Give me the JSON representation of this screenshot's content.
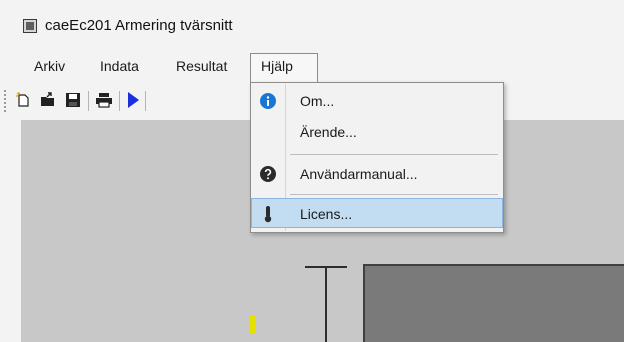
{
  "window": {
    "title": "caeEc201 Armering tvärsnitt",
    "icon": "app-window-icon"
  },
  "menubar": {
    "items": [
      {
        "label": "Arkiv"
      },
      {
        "label": "Indata"
      },
      {
        "label": "Resultat"
      },
      {
        "label": "Hjälp",
        "open": true
      }
    ]
  },
  "toolbar": {
    "buttons": [
      {
        "icon": "new-file-icon"
      },
      {
        "icon": "open-folder-icon"
      },
      {
        "icon": "save-icon"
      },
      {
        "icon": "print-icon"
      },
      {
        "icon": "run-icon",
        "color": "#1a2fe0"
      }
    ]
  },
  "help_menu": {
    "items": [
      {
        "label": "Om...",
        "icon": "info-icon",
        "icon_color": "#1976d2"
      },
      {
        "label": "Ärende...",
        "icon": ""
      },
      {
        "label": "Användarmanual...",
        "icon": "help-icon",
        "icon_color": "#2b2b2b"
      },
      {
        "label": "Licens...",
        "icon": "thermometer-icon",
        "icon_color": "#2b2b2b",
        "highlighted": true
      }
    ],
    "highlight_color": "#c2dcf2"
  },
  "canvas": {
    "background": "#c8c8c8",
    "section_fill": "#7a7a7a",
    "marker_color": "#e6df00"
  }
}
